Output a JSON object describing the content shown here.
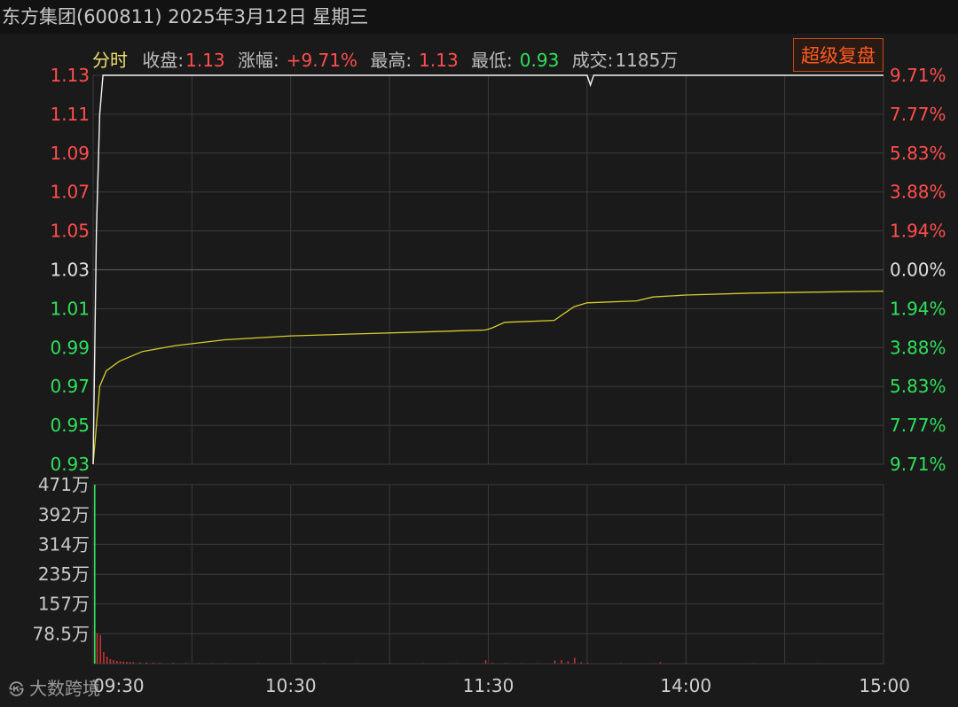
{
  "header": {
    "title": "东方集团(600811) 2025年3月12日 星期三"
  },
  "info_bar": {
    "mode": "分时",
    "close_label": "收盘:",
    "close_value": "1.13",
    "change_label": "涨幅:",
    "change_value": "+9.71%",
    "high_label": "最高:",
    "high_value": "1.13",
    "low_label": "最低:",
    "low_value": "0.93",
    "volume_label": "成交:",
    "volume_value": "1185万"
  },
  "replay_button": "超级复盘",
  "watermark": "大数跨境",
  "colors": {
    "background": "#1a1a1a",
    "up": "#ff4d4d",
    "down": "#2ee05a",
    "neutral": "#e0e0e0",
    "price_line": "#f5f5f5",
    "avg_line": "#d6cc2a",
    "grid": "#3a3a3a",
    "volume_bar": "#c83232"
  },
  "chart_data": {
    "type": "line",
    "title": "",
    "x_ticks": [
      "09:30",
      "10:30",
      "11:30",
      "14:00",
      "15:00"
    ],
    "ylim": [
      0.93,
      1.13
    ],
    "prev_close": 1.03,
    "price_ticks": [
      {
        "label": "1.13",
        "pct": "9.71%",
        "tone": "up"
      },
      {
        "label": "1.11",
        "pct": "7.77%",
        "tone": "up"
      },
      {
        "label": "1.09",
        "pct": "5.83%",
        "tone": "up"
      },
      {
        "label": "1.07",
        "pct": "3.88%",
        "tone": "up"
      },
      {
        "label": "1.05",
        "pct": "1.94%",
        "tone": "up"
      },
      {
        "label": "1.03",
        "pct": "0.00%",
        "tone": "neutral"
      },
      {
        "label": "1.01",
        "pct": "1.94%",
        "tone": "down"
      },
      {
        "label": "0.99",
        "pct": "3.88%",
        "tone": "down"
      },
      {
        "label": "0.97",
        "pct": "5.83%",
        "tone": "down"
      },
      {
        "label": "0.95",
        "pct": "7.77%",
        "tone": "down"
      },
      {
        "label": "0.93",
        "pct": "9.71%",
        "tone": "down"
      }
    ],
    "series": [
      {
        "key": "price",
        "points": [
          [
            0,
            0.93
          ],
          [
            1,
            1.05
          ],
          [
            2,
            1.11
          ],
          [
            3,
            1.13
          ],
          [
            4,
            1.13
          ],
          [
            60,
            1.13
          ],
          [
            120,
            1.13
          ],
          [
            150,
            1.13
          ],
          [
            151,
            1.125
          ],
          [
            152,
            1.13
          ],
          [
            180,
            1.13
          ],
          [
            240,
            1.13
          ]
        ]
      },
      {
        "key": "avg",
        "points": [
          [
            0,
            0.93
          ],
          [
            1,
            0.95
          ],
          [
            2,
            0.97
          ],
          [
            4,
            0.978
          ],
          [
            8,
            0.983
          ],
          [
            15,
            0.988
          ],
          [
            25,
            0.991
          ],
          [
            40,
            0.994
          ],
          [
            60,
            0.996
          ],
          [
            80,
            0.997
          ],
          [
            100,
            0.998
          ],
          [
            119,
            0.999
          ],
          [
            121,
            1.0
          ],
          [
            125,
            1.003
          ],
          [
            140,
            1.004
          ],
          [
            146,
            1.011
          ],
          [
            150,
            1.013
          ],
          [
            165,
            1.014
          ],
          [
            170,
            1.016
          ],
          [
            180,
            1.017
          ],
          [
            200,
            1.018
          ],
          [
            220,
            1.0185
          ],
          [
            240,
            1.019
          ]
        ]
      }
    ],
    "volume": {
      "ylim": [
        0,
        4710000
      ],
      "tick_labels": [
        "471万",
        "392万",
        "314万",
        "235万",
        "157万",
        "78.5万"
      ],
      "tick_values": [
        4710000,
        3920000,
        3140000,
        2350000,
        1570000,
        785000
      ],
      "bars": [
        [
          0,
          4710000
        ],
        [
          1,
          800000
        ],
        [
          2,
          750000
        ],
        [
          3,
          300000
        ],
        [
          4,
          180000
        ],
        [
          5,
          120000
        ],
        [
          6,
          90000
        ],
        [
          7,
          70000
        ],
        [
          8,
          60000
        ],
        [
          9,
          50000
        ],
        [
          10,
          45000
        ],
        [
          11,
          40000
        ],
        [
          12,
          35000
        ],
        [
          14,
          30000
        ],
        [
          16,
          28000
        ],
        [
          18,
          25000
        ],
        [
          20,
          20000
        ],
        [
          24,
          18000
        ],
        [
          28,
          16000
        ],
        [
          32,
          14000
        ],
        [
          36,
          12000
        ],
        [
          40,
          12000
        ],
        [
          50,
          10000
        ],
        [
          60,
          10000
        ],
        [
          70,
          10000
        ],
        [
          80,
          9000
        ],
        [
          90,
          9000
        ],
        [
          100,
          8000
        ],
        [
          110,
          8000
        ],
        [
          119,
          90000
        ],
        [
          121,
          20000
        ],
        [
          125,
          15000
        ],
        [
          130,
          12000
        ],
        [
          135,
          12000
        ],
        [
          140,
          80000
        ],
        [
          142,
          90000
        ],
        [
          144,
          60000
        ],
        [
          146,
          150000
        ],
        [
          148,
          40000
        ],
        [
          150,
          20000
        ],
        [
          160,
          12000
        ],
        [
          170,
          8000
        ],
        [
          172,
          40000
        ],
        [
          180,
          10000
        ],
        [
          200,
          8000
        ],
        [
          220,
          8000
        ],
        [
          239,
          8000
        ]
      ]
    }
  }
}
